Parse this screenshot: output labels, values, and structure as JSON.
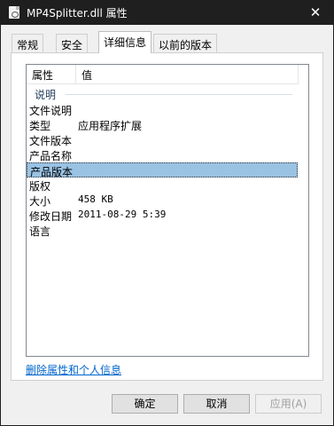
{
  "window": {
    "title": "MP4Splitter.dll 属性",
    "close_glyph": "✕",
    "file_icon": "dll-file-icon"
  },
  "tabs": [
    {
      "label": "常规"
    },
    {
      "label": "安全"
    },
    {
      "label": "详细信息"
    },
    {
      "label": "以前的版本"
    }
  ],
  "details": {
    "headers": {
      "property": "属性",
      "value": "值"
    },
    "group": "说明",
    "rows": [
      {
        "name": "文件说明",
        "value": ""
      },
      {
        "name": "类型",
        "value": "应用程序扩展"
      },
      {
        "name": "文件版本",
        "value": ""
      },
      {
        "name": "产品名称",
        "value": ""
      },
      {
        "name": "产品版本",
        "value": ""
      },
      {
        "name": "版权",
        "value": ""
      },
      {
        "name": "大小",
        "value": "458 KB"
      },
      {
        "name": "修改日期",
        "value": "2011-08-29 5:39"
      },
      {
        "name": "语言",
        "value": ""
      }
    ],
    "selected_row": "产品版本"
  },
  "link": {
    "label": "删除属性和个人信息"
  },
  "buttons": {
    "ok": "确定",
    "cancel": "取消",
    "apply": "应用(A)"
  }
}
